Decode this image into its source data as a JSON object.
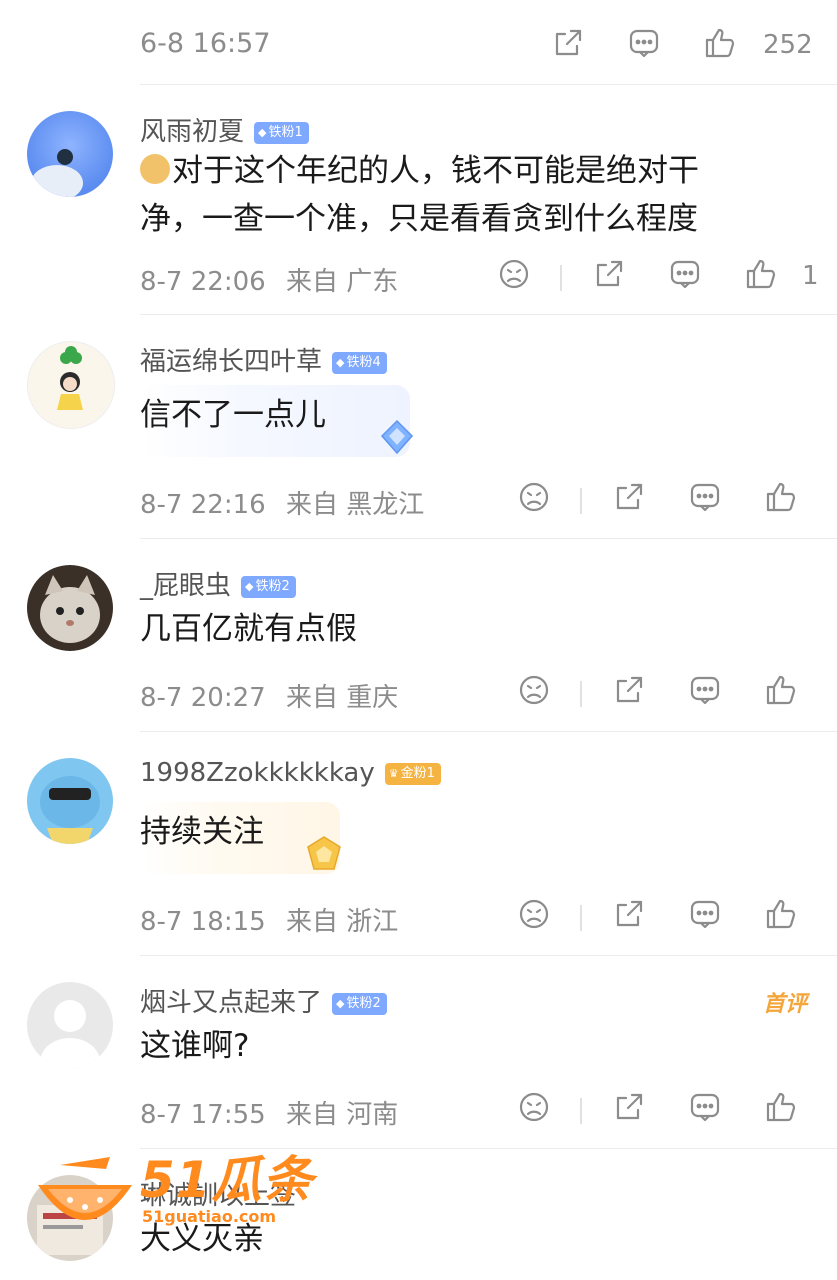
{
  "top": {
    "time": "6-8 16:57",
    "like_count": "252"
  },
  "comments": [
    {
      "name": "风雨初夏",
      "badge": "铁粉1",
      "text_line1": "对于这个年纪的人，钱不可能是绝对干",
      "text_line2": "净，一查一个准，只是看看贪到什么程度",
      "time": "8-7 22:06",
      "loc_prefix": "来自",
      "loc": "广东",
      "like_count": "1"
    },
    {
      "name": "福运绵长四叶草",
      "badge": "铁粉4",
      "text": "信不了一点儿",
      "time": "8-7 22:16",
      "loc_prefix": "来自",
      "loc": "黑龙江"
    },
    {
      "name": "_屁眼虫",
      "badge": "铁粉2",
      "text": "几百亿就有点假",
      "time": "8-7 20:27",
      "loc_prefix": "来自",
      "loc": "重庆"
    },
    {
      "name": "1998Zzokkkkkkay",
      "badge": "金粉1",
      "text": "持续关注",
      "time": "8-7 18:15",
      "loc_prefix": "来自",
      "loc": "浙江"
    },
    {
      "name": "烟斗又点起来了",
      "badge": "铁粉2",
      "tag": "首评",
      "text": "这谁啊?",
      "time": "8-7 17:55",
      "loc_prefix": "来自",
      "loc": "河南"
    },
    {
      "name": "琳诚訓以上签",
      "text": "大义灭亲"
    }
  ],
  "watermark": {
    "brand": "51瓜条",
    "url": "51guatiao.com"
  },
  "icons": {
    "share": "share-icon",
    "comment": "comment-icon",
    "like": "thumbs-up-icon",
    "dislike": "sad-face-icon"
  },
  "colors": {
    "meta_gray": "#8c8c8c",
    "iron_badge": "#7fa8ff",
    "gold_badge": "#f5b342",
    "watermark": "#ff8a1e"
  }
}
